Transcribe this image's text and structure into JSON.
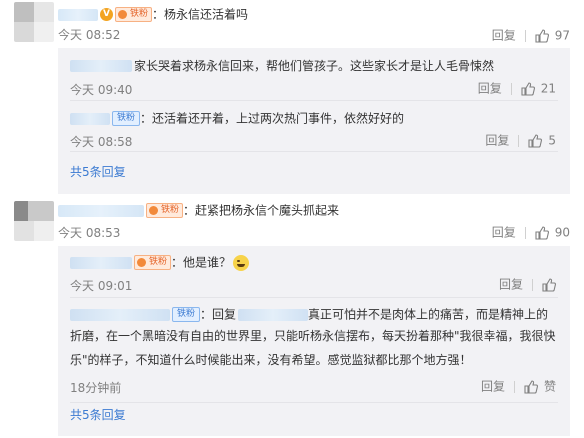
{
  "comments": [
    {
      "name_blurred": true,
      "v_badge": "V",
      "fan_badge": "铁粉",
      "separator": "：",
      "text": "杨永信还活着吗",
      "time": "今天 08:52",
      "reply_label": "回复",
      "like_count": "97",
      "replies": [
        {
          "text": "家长哭着求杨永信回来，帮他们管孩子。这些家长才是让人毛骨悚然",
          "time": "今天 09:40",
          "reply_label": "回复",
          "like_count": "21"
        },
        {
          "fan_badge": "铁粉",
          "separator": "：",
          "text": "还活着还开着，上过两次热门事件，依然好好的",
          "time": "今天 08:58",
          "reply_label": "回复",
          "like_count": "5"
        }
      ],
      "more_replies": "共5条回复"
    },
    {
      "fan_badge": "铁粉",
      "separator": "：",
      "text": "赶紧把杨永信个魔头抓起来",
      "time": "今天 08:53",
      "reply_label": "回复",
      "like_count": "90",
      "replies": [
        {
          "fan_badge": "铁粉",
          "separator": "：",
          "text": "他是谁？",
          "time": "今天 09:01",
          "reply_label": "回复",
          "like_count": ""
        },
        {
          "fan_badge": "铁粉",
          "reply_prefix": "：回复",
          "line1": "真正可怕并不是肉体上的痛苦，而是精神上的",
          "line2": "折磨，在一个黑暗没有自由的世界里，只能听杨永信摆布，每天扮着那种\"我很幸福，我很快",
          "line3": "乐\"的样子，不知道什么时候能出来，没有希望。感觉监狱都比那个地方强！",
          "time": "18分钟前",
          "reply_label": "回复",
          "like_label": "赞"
        }
      ],
      "more_replies": "共5条回复"
    }
  ],
  "colors": {
    "link": "#3c7bd2",
    "meta": "#808080",
    "reply_bg": "#f2f2f5",
    "fan_badge": "#e4642a"
  },
  "icons": {
    "like": "thumbs-up-icon",
    "emoji": "laughing-emoji-icon"
  }
}
